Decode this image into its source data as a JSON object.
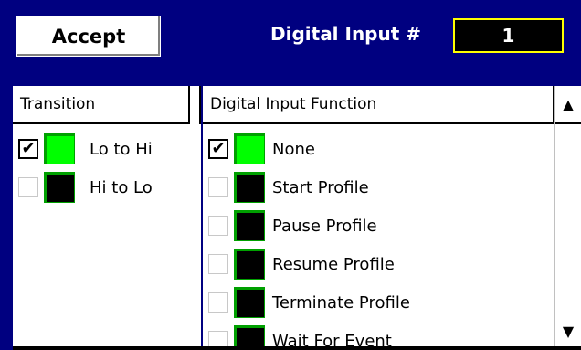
{
  "header": {
    "accept_label": "Accept",
    "digital_input_label": "Digital Input #",
    "digital_input_value": "1"
  },
  "transition": {
    "header": "Transition",
    "items": [
      {
        "label": "Lo to Hi",
        "checked": true,
        "state": "on"
      },
      {
        "label": "Hi to Lo",
        "checked": false,
        "state": "off"
      }
    ]
  },
  "function": {
    "header": "Digital Input Function",
    "items": [
      {
        "label": "None",
        "checked": true,
        "state": "on"
      },
      {
        "label": "Start Profile",
        "checked": false,
        "state": "off"
      },
      {
        "label": "Pause Profile",
        "checked": false,
        "state": "off"
      },
      {
        "label": "Resume Profile",
        "checked": false,
        "state": "off"
      },
      {
        "label": "Terminate Profile",
        "checked": false,
        "state": "off"
      },
      {
        "label": "Wait For Event",
        "checked": false,
        "state": "off"
      }
    ]
  },
  "scrollbar": {
    "up_icon": "▲",
    "down_icon": "▼"
  },
  "colors": {
    "background": "#000080",
    "indicator_on": "#00ff00",
    "indicator_off": "#000000",
    "value_border": "#ffff00"
  }
}
